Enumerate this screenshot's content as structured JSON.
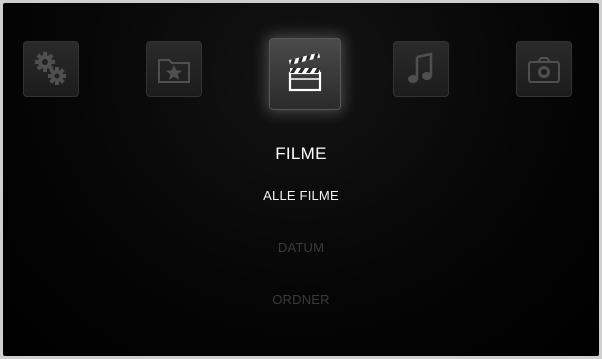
{
  "nav": {
    "items": [
      {
        "id": "settings",
        "icon": "gears-icon",
        "active": false
      },
      {
        "id": "favorites",
        "icon": "star-folder-icon",
        "active": false
      },
      {
        "id": "movies",
        "icon": "clapperboard-icon",
        "active": true
      },
      {
        "id": "music",
        "icon": "music-note-icon",
        "active": false
      },
      {
        "id": "photos",
        "icon": "camera-icon",
        "active": false
      }
    ]
  },
  "section": {
    "title": "FILME"
  },
  "menu": {
    "items": [
      {
        "label": "ALLE FILME",
        "selected": true
      },
      {
        "label": "DATUM",
        "selected": false
      },
      {
        "label": "ORDNER",
        "selected": false
      }
    ]
  },
  "colors": {
    "background": "#000000",
    "text_active": "#ffffff",
    "text_dim": "#3a3a3a",
    "icon_inactive": "#4d4d4d",
    "icon_active": "#ffffff"
  }
}
